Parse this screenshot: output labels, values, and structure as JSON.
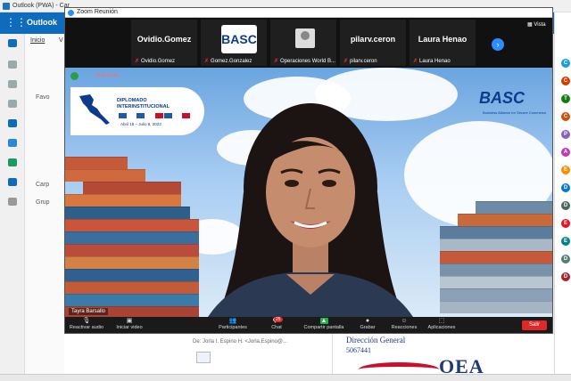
{
  "outlook": {
    "window_title": "Outlook (PWA) - Car",
    "app_name": "Outlook",
    "nav_tabs": [
      "Inicio",
      "V"
    ],
    "nav_items": [
      "Favo",
      "Carp",
      "Grup"
    ],
    "mail_snippet": "De: Jorla I. Espino H. <Jorla.Espino@...",
    "signature": {
      "title": "Dirección General",
      "number": "5067441",
      "logo_text": "OEA"
    },
    "contact_avatars": [
      {
        "letter": "C",
        "color": "#1f9bd8"
      },
      {
        "letter": "C",
        "color": "#d83b01"
      },
      {
        "letter": "T",
        "color": "#107c10"
      },
      {
        "letter": "C",
        "color": "#ca5010"
      },
      {
        "letter": "P",
        "color": "#8764b8"
      },
      {
        "letter": "A",
        "color": "#c239b3"
      },
      {
        "letter": "E",
        "color": "#ff8c00"
      },
      {
        "letter": "D",
        "color": "#0078d4"
      },
      {
        "letter": "D",
        "color": "#486860"
      },
      {
        "letter": "E",
        "color": "#e81123"
      },
      {
        "letter": "E",
        "color": "#038387"
      },
      {
        "letter": "D",
        "color": "#567c73"
      },
      {
        "letter": "D",
        "color": "#a4262c"
      }
    ]
  },
  "zoom": {
    "title": "Zoom Reunión",
    "view_label": "Vista",
    "participants_strip": [
      {
        "big_name": "Ovidio.Gomez",
        "name": "Ovidio.Gomez",
        "type": "text"
      },
      {
        "big_name": "",
        "name": "Gomez.Gonzalez",
        "type": "logo",
        "logo": "BASC"
      },
      {
        "big_name": "",
        "name": "Operaciones World B...",
        "type": "avatar"
      },
      {
        "big_name": "pilarv.ceron",
        "name": "pilarv.ceron",
        "type": "text"
      },
      {
        "big_name": "Laura Henao",
        "name": "Laura Henao",
        "type": "text"
      }
    ],
    "recording_label": "Grabando...",
    "speaker_name": "Tayra Barsallo",
    "background": {
      "banner_title_line1": "DIPLOMADO",
      "banner_title_line2": "INTERINSTITUCIONAL",
      "banner_date": "Abril 18 – Julio 8, 2023",
      "logo": "BASC",
      "logo_sub": "Business Alliance for Secure Commerce",
      "flags": [
        "#1f5aa6",
        "#ffffff",
        "#1f5aa6",
        "#ffffff",
        "#c8102e",
        "#1f5aa6",
        "#ffffff",
        "#c8102e"
      ]
    },
    "controls": [
      {
        "label": "Reactivar audio",
        "icon": "🎤"
      },
      {
        "label": "Iniciar video",
        "icon": "▣"
      },
      {
        "label": "Participantes",
        "icon": "👥",
        "count": "22"
      },
      {
        "label": "Chat",
        "icon": "💬",
        "badge": "25"
      },
      {
        "label": "Compartir pantalla",
        "icon": "▲"
      },
      {
        "label": "Grabar",
        "icon": "●"
      },
      {
        "label": "Reacciones",
        "icon": "☺"
      },
      {
        "label": "Aplicaciones",
        "icon": "⬚"
      }
    ],
    "leave_label": "Salir"
  }
}
